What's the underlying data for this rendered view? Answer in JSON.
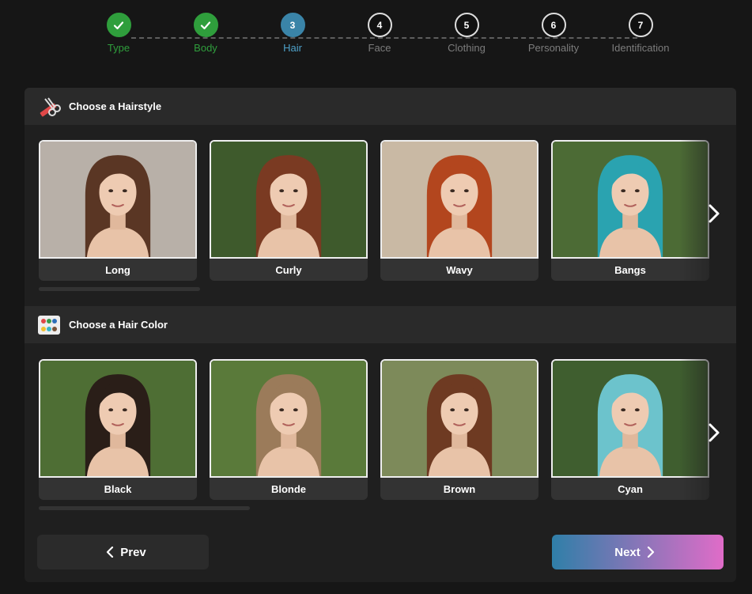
{
  "stepper": {
    "steps": [
      {
        "number": "1",
        "label": "Type",
        "state": "done"
      },
      {
        "number": "2",
        "label": "Body",
        "state": "done"
      },
      {
        "number": "3",
        "label": "Hair",
        "state": "active"
      },
      {
        "number": "4",
        "label": "Face",
        "state": "pending"
      },
      {
        "number": "5",
        "label": "Clothing",
        "state": "pending"
      },
      {
        "number": "6",
        "label": "Personality",
        "state": "pending"
      },
      {
        "number": "7",
        "label": "Identification",
        "state": "pending"
      }
    ]
  },
  "hairstyle_section": {
    "title": "Choose a Hairstyle",
    "icon": "scissors-comb-icon",
    "options": [
      {
        "label": "Long",
        "hair_color": "#5a3624",
        "bg": "#b8b0a8"
      },
      {
        "label": "Curly",
        "hair_color": "#7a3a22",
        "bg": "#3e5a2c"
      },
      {
        "label": "Wavy",
        "hair_color": "#b3461e",
        "bg": "#c9b9a4"
      },
      {
        "label": "Bangs",
        "hair_color": "#2aa3b0",
        "bg": "#4c6b35"
      }
    ]
  },
  "haircolor_section": {
    "title": "Choose a Hair Color",
    "icon": "paint-palette-icon",
    "options": [
      {
        "label": "Black",
        "hair_color": "#2a1e18",
        "bg": "#4e6e34"
      },
      {
        "label": "Blonde",
        "hair_color": "#9b7b5a",
        "bg": "#5a7a3a"
      },
      {
        "label": "Brown",
        "hair_color": "#6e3a22",
        "bg": "#7d8a5a"
      },
      {
        "label": "Cyan",
        "hair_color": "#6cc3cc",
        "bg": "#3f5e2f"
      }
    ]
  },
  "nav": {
    "prev_label": "Prev",
    "next_label": "Next"
  },
  "colors": {
    "done": "#2f9e3c",
    "active": "#3a84a8",
    "next_gradient_start": "#2f7fa8",
    "next_gradient_end": "#e06cc8"
  }
}
